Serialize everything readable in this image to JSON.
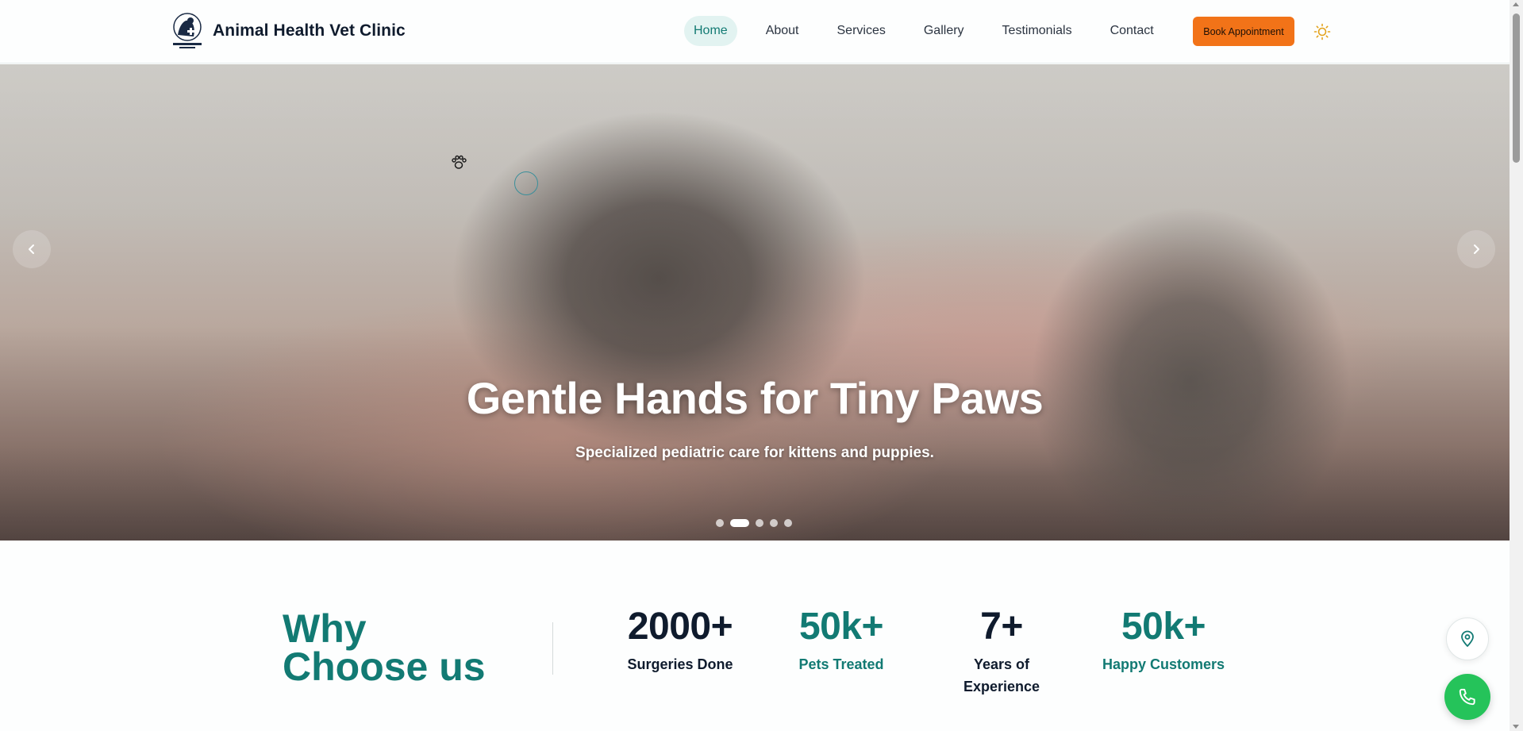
{
  "header": {
    "brand_name": "Animal Health Vet Clinic",
    "logo_icon": "vet-clinic-logo-icon",
    "nav": [
      "Home",
      "About",
      "Services",
      "Gallery",
      "Testimonials",
      "Contact"
    ],
    "active_nav": "Home",
    "book_button": "Book Appointment",
    "theme_icon": "sun-icon"
  },
  "hero": {
    "title": "Gentle Hands for Tiny Paws",
    "subtitle": "Specialized pediatric care for kittens and puppies.",
    "slide_count": 5,
    "active_slide": 2,
    "prev_icon": "chevron-left-icon",
    "next_icon": "chevron-right-icon"
  },
  "why": {
    "title": "Why Choose us",
    "stats": [
      {
        "value": "2000+",
        "label": "Surgeries Done",
        "style": "dark"
      },
      {
        "value": "50k+",
        "label": "Pets Treated",
        "style": "teal"
      },
      {
        "value": "7+",
        "label": "Years of Experience",
        "style": "dark"
      },
      {
        "value": "50k+",
        "label": "Happy Customers",
        "style": "teal"
      }
    ]
  },
  "floating": {
    "location_icon": "map-pin-icon",
    "phone_icon": "phone-icon"
  },
  "colors": {
    "accent": "#127a73",
    "cta": "#f27318",
    "phone": "#25c35a",
    "dark_text": "#0f1b2d"
  }
}
